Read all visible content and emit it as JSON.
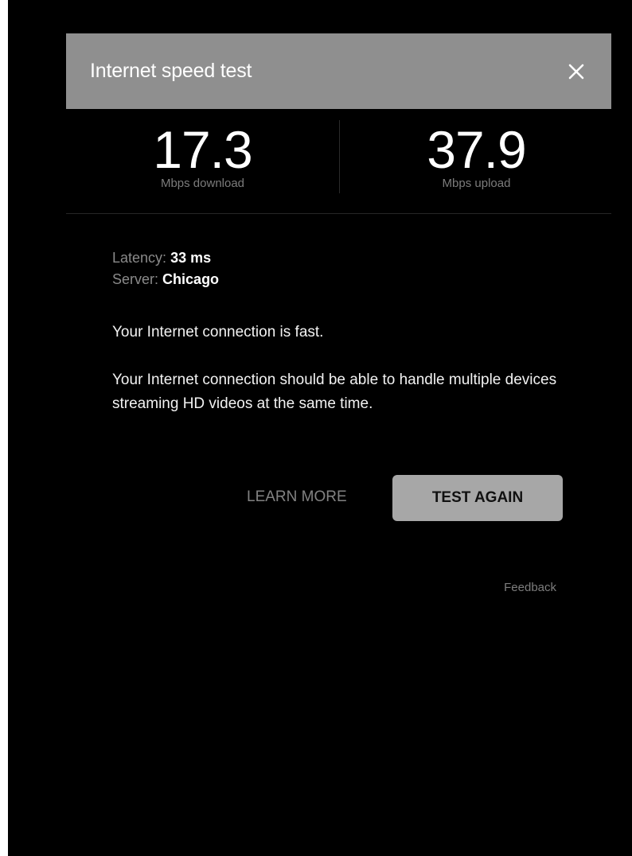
{
  "dialog": {
    "title": "Internet speed test",
    "close_label": "close-icon"
  },
  "results": {
    "download": {
      "value": "17.3",
      "unit": "Mbps download"
    },
    "upload": {
      "value": "37.9",
      "unit": "Mbps upload"
    }
  },
  "details": {
    "latency_label": "Latency:",
    "latency_value": "33 ms",
    "server_label": "Server:",
    "server_value": "Chicago"
  },
  "summary": "Your Internet connection is fast.",
  "description": "Your Internet connection should be able to handle multiple devices streaming HD videos at the same time.",
  "actions": {
    "learn_more": "LEARN MORE",
    "test_again": "TEST AGAIN"
  },
  "feedback": "Feedback",
  "colors": {
    "background": "#000000",
    "header": "#8f8f8f",
    "button": "#a7a7a7"
  }
}
